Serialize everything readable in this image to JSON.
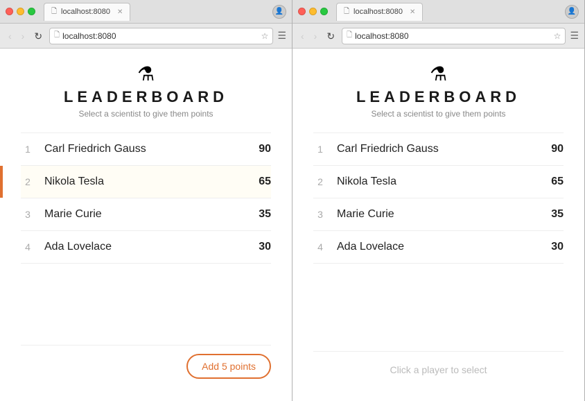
{
  "windows": [
    {
      "id": "left",
      "url": "localhost:8080",
      "tab_label": "localhost:8080",
      "selected_player_index": 1,
      "header": {
        "flask_icon": "⚗",
        "title": "LEADERBOARD",
        "subtitle": "Select a scientist to give them points"
      },
      "players": [
        {
          "rank": 1,
          "name": "Carl Friedrich Gauss",
          "score": 90
        },
        {
          "rank": 2,
          "name": "Nikola Tesla",
          "score": 65
        },
        {
          "rank": 3,
          "name": "Marie Curie",
          "score": 35
        },
        {
          "rank": 4,
          "name": "Ada Lovelace",
          "score": 30
        }
      ],
      "footer": {
        "add_button_label": "Add 5 points",
        "no_selection_text": null
      }
    },
    {
      "id": "right",
      "url": "localhost:8080",
      "tab_label": "localhost:8080",
      "selected_player_index": -1,
      "header": {
        "flask_icon": "⚗",
        "title": "LEADERBOARD",
        "subtitle": "Select a scientist to give them points"
      },
      "players": [
        {
          "rank": 1,
          "name": "Carl Friedrich Gauss",
          "score": 90
        },
        {
          "rank": 2,
          "name": "Nikola Tesla",
          "score": 65
        },
        {
          "rank": 3,
          "name": "Marie Curie",
          "score": 35
        },
        {
          "rank": 4,
          "name": "Ada Lovelace",
          "score": 30
        }
      ],
      "footer": {
        "add_button_label": null,
        "no_selection_text": "Click a player to select"
      }
    }
  ],
  "nav": {
    "back": "‹",
    "forward": "›",
    "refresh": "↻"
  }
}
